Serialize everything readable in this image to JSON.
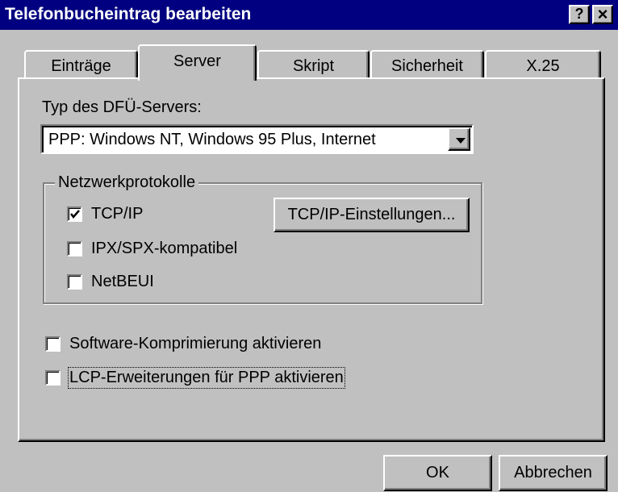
{
  "window": {
    "title": "Telefonbucheintrag bearbeiten",
    "help_label": "?",
    "close_label": "×"
  },
  "tabs": [
    {
      "label": "Einträge",
      "active": false
    },
    {
      "label": "Server",
      "active": true
    },
    {
      "label": "Skript",
      "active": false
    },
    {
      "label": "Sicherheit",
      "active": false
    },
    {
      "label": "X.25",
      "active": false
    }
  ],
  "server": {
    "type_label": "Typ des DFÜ-Servers:",
    "type_value": "PPP: Windows NT, Windows 95 Plus, Internet",
    "protocols_group": "Netzwerkprotokolle",
    "protocols": [
      {
        "label": "TCP/IP",
        "checked": true
      },
      {
        "label": "IPX/SPX-kompatibel",
        "checked": false
      },
      {
        "label": "NetBEUI",
        "checked": false
      }
    ],
    "tcpip_settings_label": "TCP/IP-Einstellungen...",
    "options": [
      {
        "label": "Software-Komprimierung aktivieren",
        "checked": false
      },
      {
        "label": "LCP-Erweiterungen für PPP aktivieren",
        "checked": false
      }
    ]
  },
  "buttons": {
    "ok": "OK",
    "cancel": "Abbrechen"
  },
  "colors": {
    "title_bar": "#000080",
    "face": "#c0c0c0"
  }
}
